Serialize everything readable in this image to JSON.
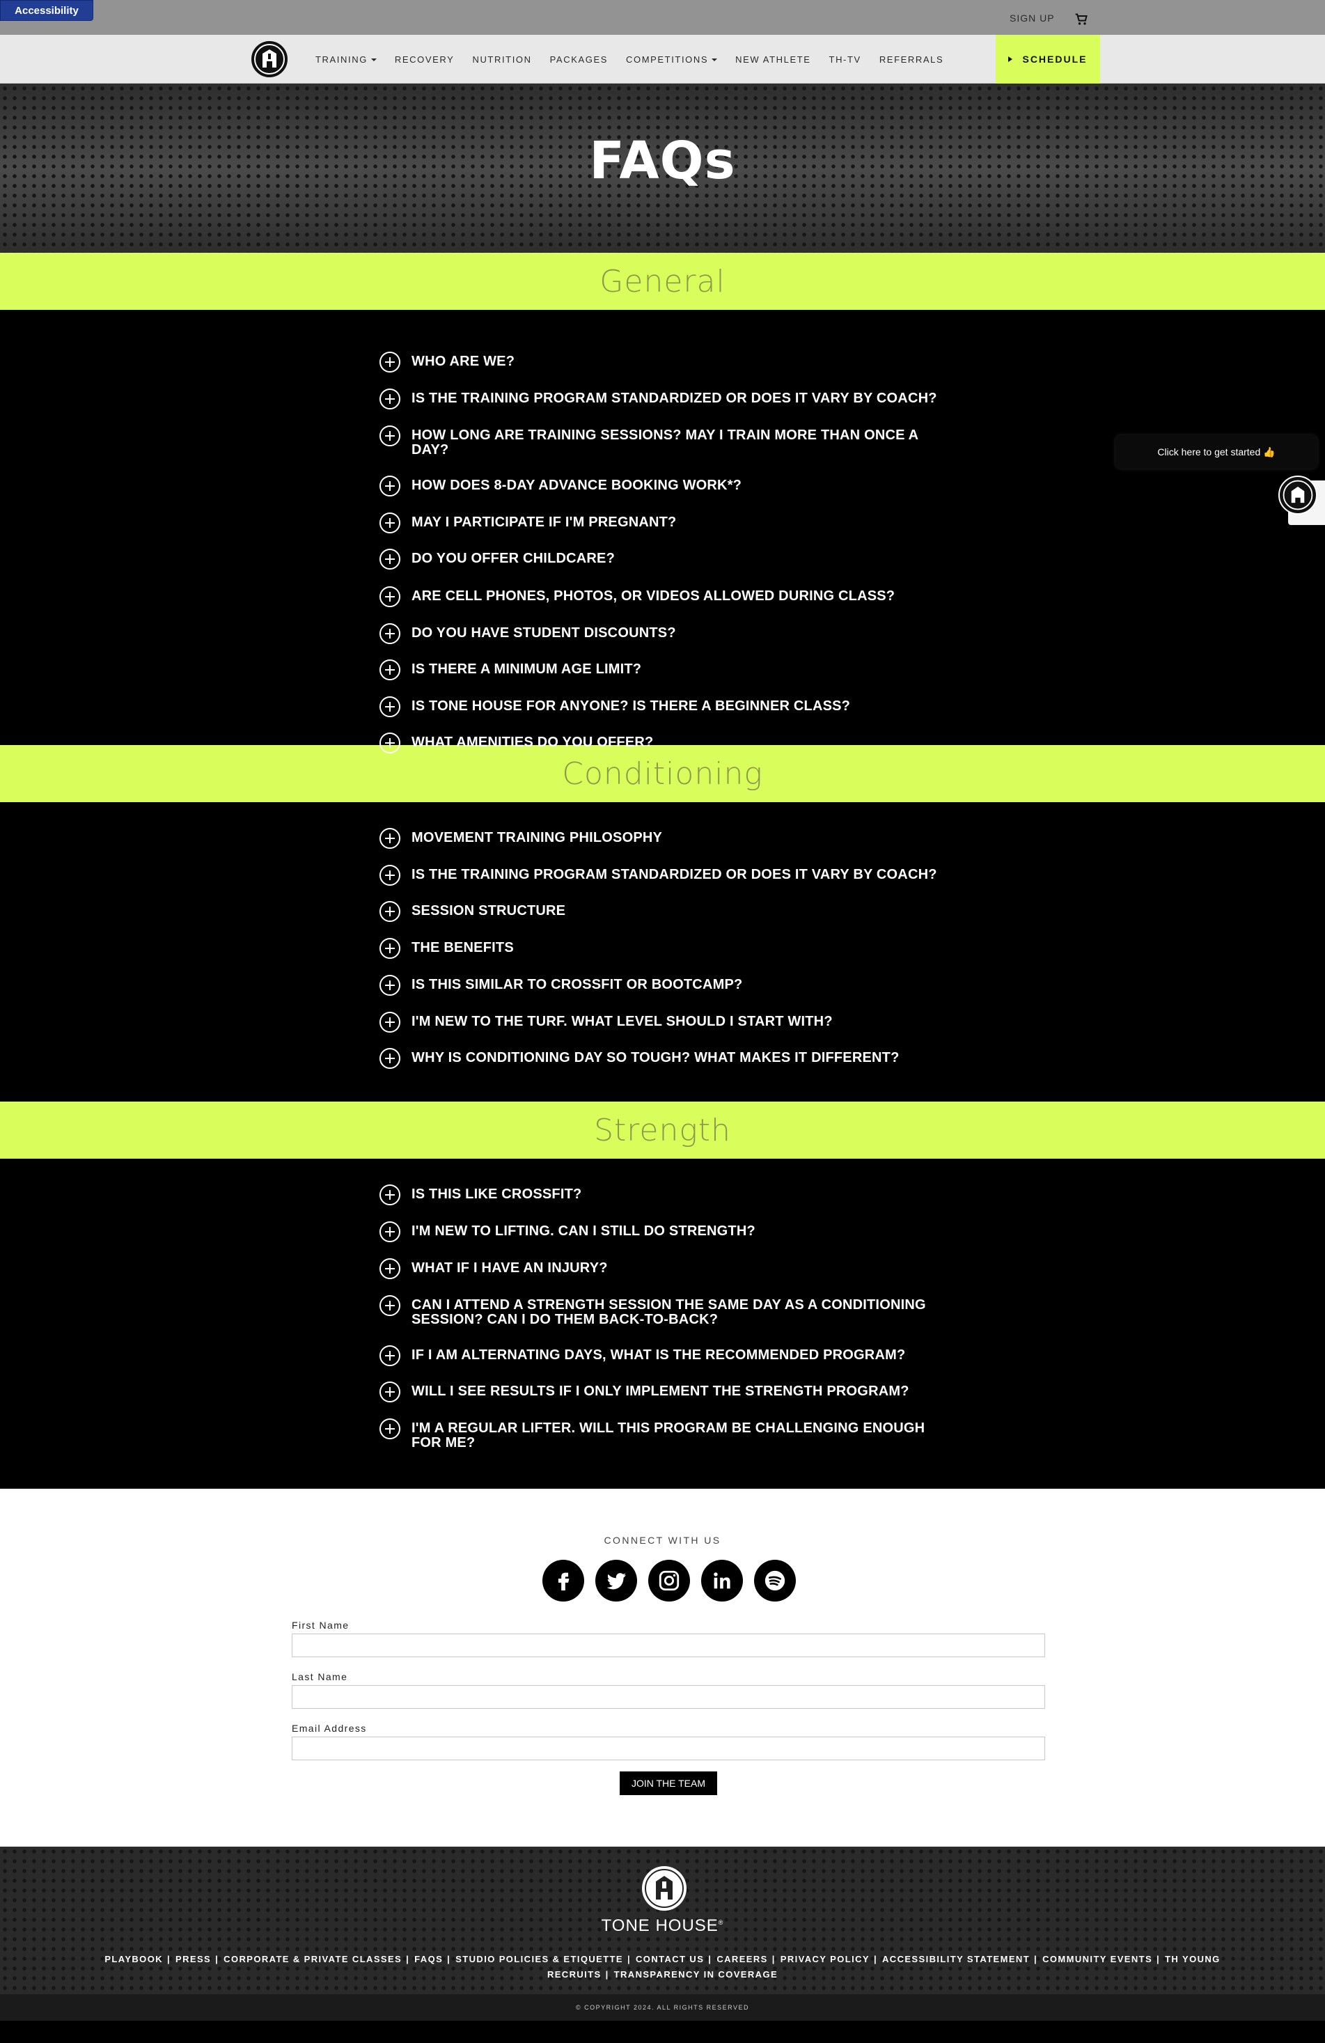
{
  "accessibility_label": "Accessibility",
  "utility": {
    "signup": "SIGN UP",
    "cart_icon": "cart-icon"
  },
  "nav": {
    "items": [
      {
        "label": "TRAINING",
        "has_caret": true
      },
      {
        "label": "RECOVERY",
        "has_caret": false
      },
      {
        "label": "NUTRITION",
        "has_caret": false
      },
      {
        "label": "PACKAGES",
        "has_caret": false
      },
      {
        "label": "COMPETITIONS",
        "has_caret": true
      },
      {
        "label": "NEW ATHLETE",
        "has_caret": false
      },
      {
        "label": "TH-TV",
        "has_caret": false
      },
      {
        "label": "REFERRALS",
        "has_caret": false
      }
    ],
    "schedule": "SCHEDULE"
  },
  "hero": {
    "title": "FAQs"
  },
  "sections": [
    {
      "title": "General",
      "questions": [
        "WHO ARE WE?",
        "IS THE TRAINING PROGRAM STANDARDIZED OR DOES IT VARY BY COACH?",
        "HOW LONG ARE TRAINING SESSIONS? MAY I TRAIN MORE THAN ONCE A DAY?",
        "HOW DOES 8-DAY ADVANCE BOOKING WORK*?",
        "MAY I PARTICIPATE IF I'M PREGNANT?",
        "DO YOU OFFER CHILDCARE?",
        "ARE CELL PHONES, PHOTOS, OR VIDEOS ALLOWED DURING CLASS?",
        "DO YOU HAVE STUDENT DISCOUNTS?",
        "IS THERE A MINIMUM AGE LIMIT?",
        "IS TONE HOUSE FOR ANYONE? IS THERE A BEGINNER CLASS?",
        "WHAT AMENITIES DO YOU OFFER?"
      ]
    },
    {
      "title": "Conditioning",
      "questions": [
        "MOVEMENT TRAINING PHILOSOPHY",
        "IS THE TRAINING PROGRAM STANDARDIZED OR DOES IT VARY BY COACH?",
        "SESSION STRUCTURE",
        "THE BENEFITS",
        "IS THIS SIMILAR TO CROSSFIT OR BOOTCAMP?",
        "I'M NEW TO THE TURF. WHAT LEVEL SHOULD I START WITH?",
        "WHY IS CONDITIONING DAY SO TOUGH? WHAT MAKES IT DIFFERENT?"
      ]
    },
    {
      "title": "Strength",
      "questions": [
        "IS THIS LIKE CROSSFIT?",
        "I'M NEW TO LIFTING. CAN I STILL DO STRENGTH?",
        "WHAT IF I HAVE AN INJURY?",
        "CAN I ATTEND A STRENGTH SESSION THE SAME DAY AS A CONDITIONING SESSION? CAN I DO THEM BACK-TO-BACK?",
        "IF I AM ALTERNATING DAYS, WHAT IS THE RECOMMENDED PROGRAM?",
        "WILL I SEE RESULTS IF I ONLY IMPLEMENT THE STRENGTH PROGRAM?",
        "I'M A REGULAR LIFTER. WILL THIS PROGRAM BE CHALLENGING ENOUGH FOR ME?"
      ]
    }
  ],
  "chat": {
    "prompt": "Click here to get started 👍"
  },
  "connect": {
    "title": "CONNECT WITH US",
    "socials": [
      "facebook-icon",
      "twitter-icon",
      "instagram-icon",
      "linkedin-icon",
      "spotify-icon"
    ],
    "first_name_label": "First Name",
    "last_name_label": "Last Name",
    "email_label": "Email Address",
    "submit": "JOIN THE TEAM"
  },
  "footer": {
    "brand": "TONE HOUSE",
    "links": [
      "PLAYBOOK",
      "PRESS",
      "CORPORATE & PRIVATE CLASSES",
      "FAQS",
      "STUDIO POLICIES & ETIQUETTE",
      "CONTACT US",
      "CAREERS",
      "PRIVACY POLICY",
      "ACCESSIBILITY STATEMENT",
      "COMMUNITY EVENTS",
      "TH YOUNG RECRUITS",
      "TRANSPARENCY IN COVERAGE"
    ],
    "copyright": "© COPYRIGHT 2024. ALL RIGHTS RESERVED"
  },
  "colors": {
    "accent": "#d9fd5b",
    "band_text": "#8a9a4a",
    "accessibility": "#213d94"
  }
}
